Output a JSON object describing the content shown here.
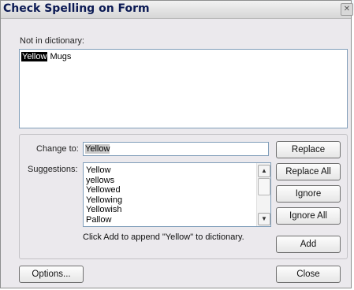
{
  "dialog": {
    "title": "Check Spelling on Form",
    "close_glyph": "✕"
  },
  "not_in_dictionary": {
    "label": "Not in dictionary:",
    "flagged_word": "Yellow",
    "rest_text": " Mugs"
  },
  "change_to": {
    "label": "Change to:",
    "value": "Yellow"
  },
  "suggestions": {
    "label": "Suggestions:",
    "items": [
      "Yellow",
      "yellows",
      "Yellowed",
      "Yellowing",
      "Yellowish",
      "Pallow"
    ]
  },
  "hint_text": "Click Add to append \"Yellow\" to dictionary.",
  "buttons": {
    "replace": "Replace",
    "replace_all": "Replace All",
    "ignore": "Ignore",
    "ignore_all": "Ignore All",
    "add": "Add",
    "options": "Options...",
    "close": "Close"
  },
  "icons": {
    "close": "close-icon",
    "scroll_up": "chevron-up-icon",
    "scroll_down": "chevron-down-icon"
  }
}
